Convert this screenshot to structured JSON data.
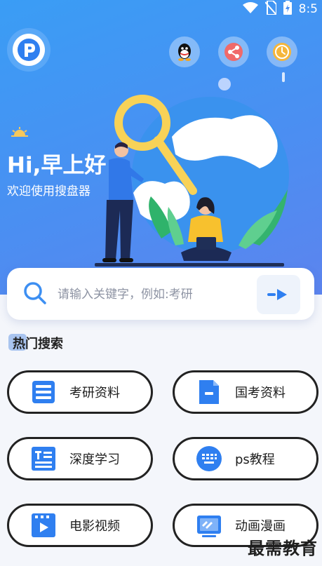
{
  "status": {
    "time": "8:5"
  },
  "greeting": {
    "title": "Hi,早上好",
    "subtitle": "欢迎使用搜盘器"
  },
  "search": {
    "placeholder": "请输入关键字，例如:考研"
  },
  "hot": {
    "title": "热门搜索"
  },
  "categories": [
    {
      "label": "考研资料",
      "icon": "database-icon"
    },
    {
      "label": "国考资料",
      "icon": "document-icon"
    },
    {
      "label": "深度学习",
      "icon": "text-icon"
    },
    {
      "label": "ps教程",
      "icon": "keyboard-icon"
    },
    {
      "label": "电影视频",
      "icon": "video-icon"
    },
    {
      "label": "动画漫画",
      "icon": "tablet-icon"
    }
  ],
  "watermark": "最需教育",
  "colors": {
    "accent": "#3d8ff2",
    "hero_top": "#3a9df5",
    "icon_blue": "#2f7ff0"
  }
}
